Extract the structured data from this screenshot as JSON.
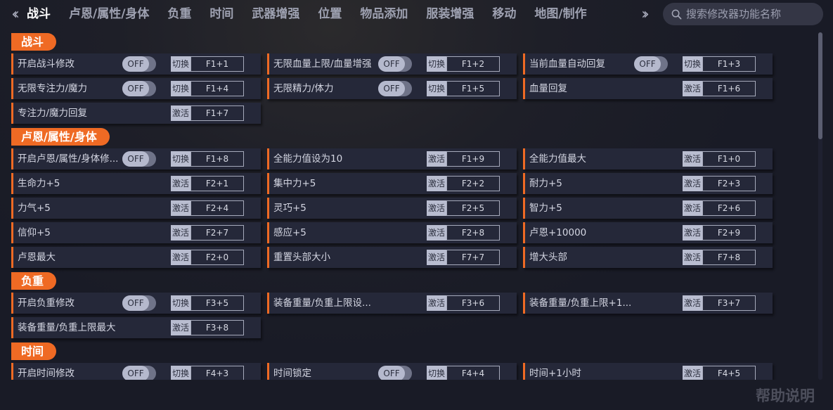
{
  "nav": {
    "tabs": [
      "战斗",
      "卢恩/属性/身体",
      "负重",
      "时间",
      "武器增强",
      "位置",
      "物品添加",
      "服装增强",
      "移动",
      "地图/制作"
    ],
    "active_tab": 0,
    "prev_icon": "double-chevron-left",
    "next_icon": "double-chevron-right"
  },
  "search": {
    "placeholder": "搜索修改器功能名称",
    "value": ""
  },
  "colors": {
    "accent": "#ef6a24",
    "row_bg": "#252839",
    "page_bg": "#191b26"
  },
  "sections": [
    {
      "title": "战斗",
      "items": [
        {
          "label": "开启战斗修改",
          "toggle": "OFF",
          "action": "切换",
          "hotkey": "F1+1"
        },
        {
          "label": "无限血量上限/血量增强",
          "toggle": "OFF",
          "action": "切换",
          "hotkey": "F1+2"
        },
        {
          "label": "当前血量自动回复",
          "toggle": "OFF",
          "action": "切换",
          "hotkey": "F1+3"
        },
        {
          "label": "无限专注力/魔力",
          "toggle": "OFF",
          "action": "切换",
          "hotkey": "F1+4"
        },
        {
          "label": "无限精力/体力",
          "toggle": "OFF",
          "action": "切换",
          "hotkey": "F1+5"
        },
        {
          "label": "血量回复",
          "toggle": null,
          "action": "激活",
          "hotkey": "F1+6"
        },
        {
          "label": "专注力/魔力回复",
          "toggle": null,
          "action": "激活",
          "hotkey": "F1+7"
        }
      ]
    },
    {
      "title": "卢恩/属性/身体",
      "items": [
        {
          "label": "开启卢恩/属性/身体修...",
          "toggle": "OFF",
          "action": "切换",
          "hotkey": "F1+8"
        },
        {
          "label": "全能力值设为10",
          "toggle": null,
          "action": "激活",
          "hotkey": "F1+9"
        },
        {
          "label": "全能力值最大",
          "toggle": null,
          "action": "激活",
          "hotkey": "F1+0"
        },
        {
          "label": "生命力+5",
          "toggle": null,
          "action": "激活",
          "hotkey": "F2+1"
        },
        {
          "label": "集中力+5",
          "toggle": null,
          "action": "激活",
          "hotkey": "F2+2"
        },
        {
          "label": "耐力+5",
          "toggle": null,
          "action": "激活",
          "hotkey": "F2+3"
        },
        {
          "label": "力气+5",
          "toggle": null,
          "action": "激活",
          "hotkey": "F2+4"
        },
        {
          "label": "灵巧+5",
          "toggle": null,
          "action": "激活",
          "hotkey": "F2+5"
        },
        {
          "label": "智力+5",
          "toggle": null,
          "action": "激活",
          "hotkey": "F2+6"
        },
        {
          "label": "信仰+5",
          "toggle": null,
          "action": "激活",
          "hotkey": "F2+7"
        },
        {
          "label": "感应+5",
          "toggle": null,
          "action": "激活",
          "hotkey": "F2+8"
        },
        {
          "label": "卢恩+10000",
          "toggle": null,
          "action": "激活",
          "hotkey": "F2+9"
        },
        {
          "label": "卢恩最大",
          "toggle": null,
          "action": "激活",
          "hotkey": "F2+0"
        },
        {
          "label": "重置头部大小",
          "toggle": null,
          "action": "激活",
          "hotkey": "F7+7"
        },
        {
          "label": "增大头部",
          "toggle": null,
          "action": "激活",
          "hotkey": "F7+8"
        }
      ]
    },
    {
      "title": "负重",
      "items": [
        {
          "label": "开启负重修改",
          "toggle": "OFF",
          "action": "切换",
          "hotkey": "F3+5"
        },
        {
          "label": "装备重量/负重上限设...",
          "toggle": null,
          "action": "激活",
          "hotkey": "F3+6"
        },
        {
          "label": "装备重量/负重上限+1...",
          "toggle": null,
          "action": "激活",
          "hotkey": "F3+7"
        },
        {
          "label": "装备重量/负重上限最大",
          "toggle": null,
          "action": "激活",
          "hotkey": "F3+8"
        }
      ]
    },
    {
      "title": "时间",
      "items": [
        {
          "label": "开启时间修改",
          "toggle": "OFF",
          "action": "切换",
          "hotkey": "F4+3"
        },
        {
          "label": "时间锁定",
          "toggle": "OFF",
          "action": "切换",
          "hotkey": "F4+4"
        },
        {
          "label": "时间+1小时",
          "toggle": null,
          "action": "激活",
          "hotkey": "F4+5"
        }
      ]
    }
  ],
  "help_label": "帮助说明"
}
